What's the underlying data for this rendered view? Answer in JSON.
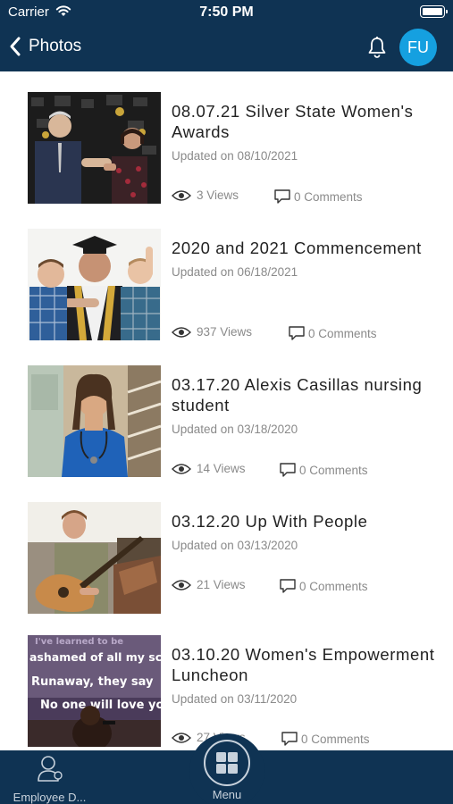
{
  "status": {
    "carrier": "Carrier",
    "time": "7:50 PM"
  },
  "header": {
    "back_label": "Photos",
    "avatar_initials": "FU"
  },
  "albums": [
    {
      "title": "08.07.21 Silver State Women's Awards",
      "updated": "Updated on 08/10/2021",
      "views": "3 Views",
      "comments": "0 Comments"
    },
    {
      "title": "2020 and 2021 Commencement",
      "updated": "Updated on 06/18/2021",
      "views": "937 Views",
      "comments": "0 Comments"
    },
    {
      "title": "03.17.20 Alexis Casillas nursing student",
      "updated": "Updated on 03/18/2020",
      "views": "14 Views",
      "comments": "0 Comments"
    },
    {
      "title": "03.12.20 Up With People",
      "updated": "Updated on 03/13/2020",
      "views": "21 Views",
      "comments": "0 Comments"
    },
    {
      "title": "03.10.20 Women's Empowerment Luncheon",
      "updated": "Updated on 03/11/2020",
      "views": "27 Views",
      "comments": "0 Comments"
    }
  ],
  "thumb5_text": [
    "I've learned to be",
    "ashamed of all my scars",
    "Runaway, they say",
    "No one will love you"
  ],
  "tabbar": {
    "directory_label": "Employee D...",
    "menu_label": "Menu"
  },
  "colors": {
    "nav": "#0f3353",
    "accent": "#15a0e0",
    "muted": "#8a8a8a"
  },
  "icons": [
    "chevron-left-icon",
    "bell-icon",
    "eye-icon",
    "comment-icon",
    "person-icon",
    "grid-icon",
    "wifi-icon",
    "battery-icon"
  ]
}
